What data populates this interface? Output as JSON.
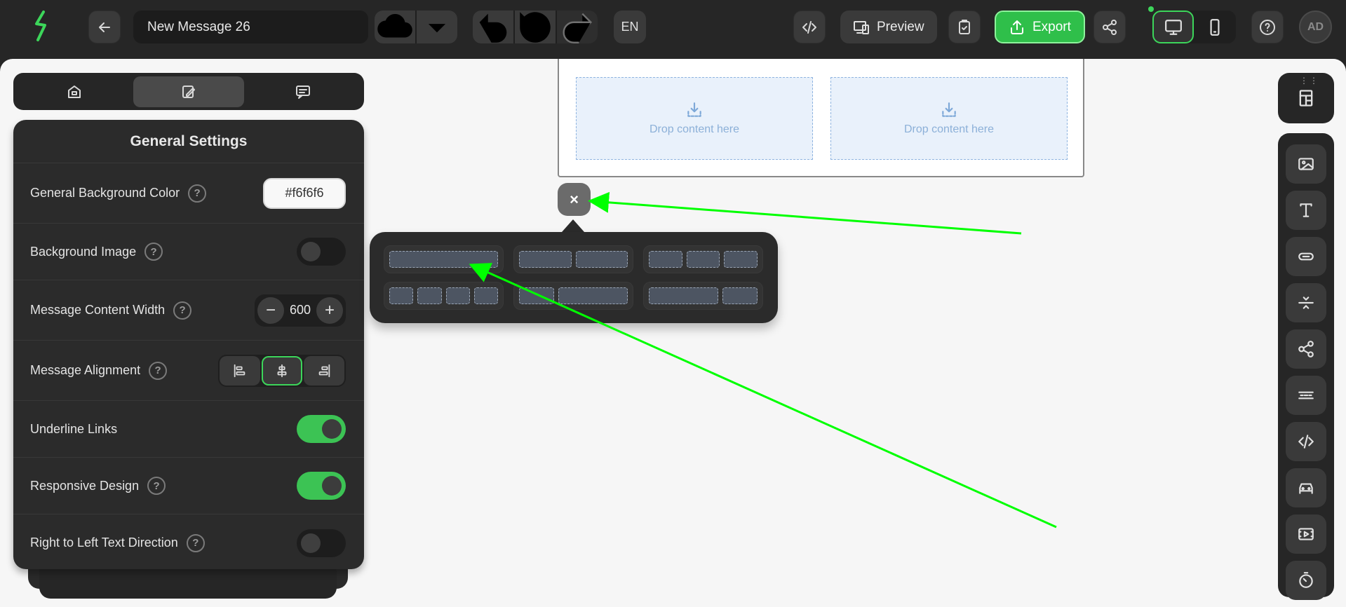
{
  "header": {
    "back_icon": "arrow-left-icon",
    "logo_icon": "lightning-logo-icon",
    "message_title": "New Message 26",
    "language": "EN",
    "preview_label": "Preview",
    "export_label": "Export",
    "avatar_initials": "AD"
  },
  "left_panel": {
    "tabs": [
      {
        "icon": "content-icon"
      },
      {
        "icon": "design-icon",
        "active": true
      },
      {
        "icon": "comments-icon"
      }
    ],
    "title": "General Settings",
    "background_color_label": "General Background Color",
    "background_color_value": "#f6f6f6",
    "background_image_label": "Background Image",
    "content_width_label": "Message Content Width",
    "content_width_value": "600",
    "alignment_label": "Message Alignment",
    "underline_links_label": "Underline Links",
    "responsive_label": "Responsive Design",
    "rtl_label": "Right to Left Text Direction"
  },
  "email": {
    "drop_text_1": "Drop content here",
    "drop_text_2": "Drop content here"
  },
  "popup": {
    "close_glyph": "×"
  },
  "colors": {
    "accent": "#3cd65a",
    "export_bg": "#2fbf4a",
    "annotation": "#00ff00"
  }
}
